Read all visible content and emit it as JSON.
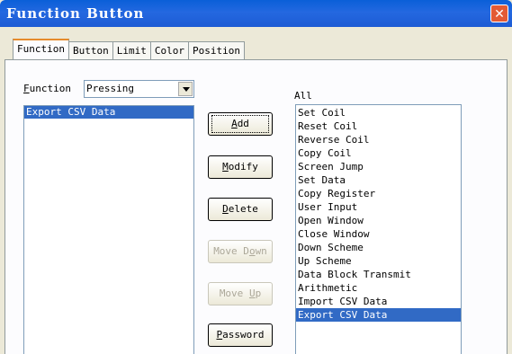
{
  "window": {
    "title": "Function Button",
    "close_glyph": "✕"
  },
  "tabs": [
    {
      "label": "Function",
      "active": true
    },
    {
      "label": "Button",
      "active": false
    },
    {
      "label": "Limit",
      "active": false
    },
    {
      "label": "Color",
      "active": false
    },
    {
      "label": "Position",
      "active": false
    }
  ],
  "function_field": {
    "label_first": "F",
    "label_rest": "unction",
    "value": "Pressing"
  },
  "selected_functions": [
    "Export CSV Data"
  ],
  "all_label": "All",
  "all_functions": [
    "Set Coil",
    "Reset Coil",
    "Reverse Coil",
    "Copy Coil",
    "Screen Jump",
    "Set Data",
    "Copy Register",
    "User Input",
    "Open Window",
    "Close Window",
    "Down Scheme",
    "Up Scheme",
    "Data Block Transmit",
    "Arithmetic",
    "Import CSV Data",
    "Export CSV Data"
  ],
  "all_selected_index": 15,
  "buttons": {
    "add": {
      "first": "A",
      "rest": "dd",
      "enabled": true
    },
    "modify": {
      "first": "M",
      "rest": "odify",
      "enabled": true
    },
    "delete": {
      "first": "D",
      "rest": "elete",
      "enabled": true
    },
    "move_down": {
      "pre": "Move D",
      "ul": "o",
      "post": "wn",
      "enabled": false
    },
    "move_up": {
      "pre": "Move ",
      "ul": "U",
      "post": "p",
      "enabled": false
    },
    "password": {
      "first": "P",
      "rest": "assword",
      "enabled": true
    }
  },
  "colors": {
    "title_bar": "#1d5bd4",
    "selection": "#316ac5",
    "close_button": "#e35a34",
    "dialog_bg": "#ece9d8"
  }
}
